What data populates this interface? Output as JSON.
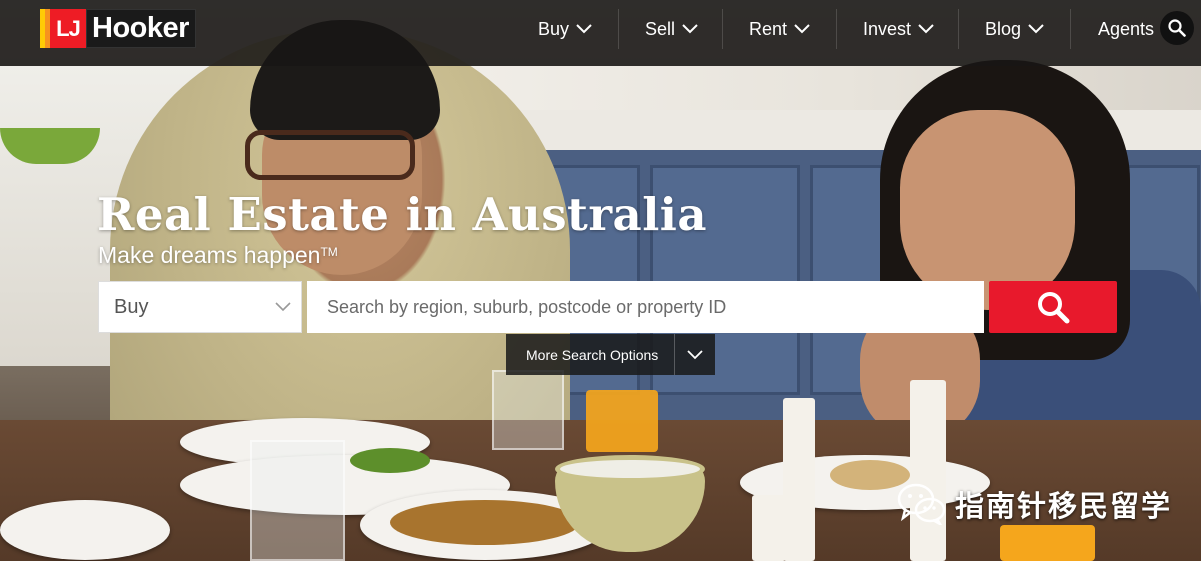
{
  "brand": {
    "logo_mark": "LJ",
    "logo_text": "Hooker",
    "colors": {
      "red": "#ee1c25",
      "yellow": "#ffcb05",
      "orange": "#f7931e",
      "dark": "#1a1a1a"
    }
  },
  "header": {
    "nav": [
      {
        "label": "Buy",
        "icon": "chevron-down-icon"
      },
      {
        "label": "Sell",
        "icon": "chevron-down-icon"
      },
      {
        "label": "Rent",
        "icon": "chevron-down-icon"
      },
      {
        "label": "Invest",
        "icon": "chevron-down-icon"
      },
      {
        "label": "Blog",
        "icon": "chevron-down-icon"
      },
      {
        "label": "Agents"
      }
    ],
    "search_icon": "search-icon"
  },
  "hero": {
    "title": "Real Estate in Australia",
    "subtitle": "Make dreams happen",
    "subtitle_mark": "TM"
  },
  "search": {
    "type_selected": "Buy",
    "placeholder": "Search by region, suburb, postcode or property ID",
    "value": "",
    "button_icon": "search-icon",
    "button_color": "#e8192c",
    "more_options_label": "More Search Options"
  },
  "watermark": {
    "text": "指南针移民留学",
    "icon": "wechat-icon"
  }
}
